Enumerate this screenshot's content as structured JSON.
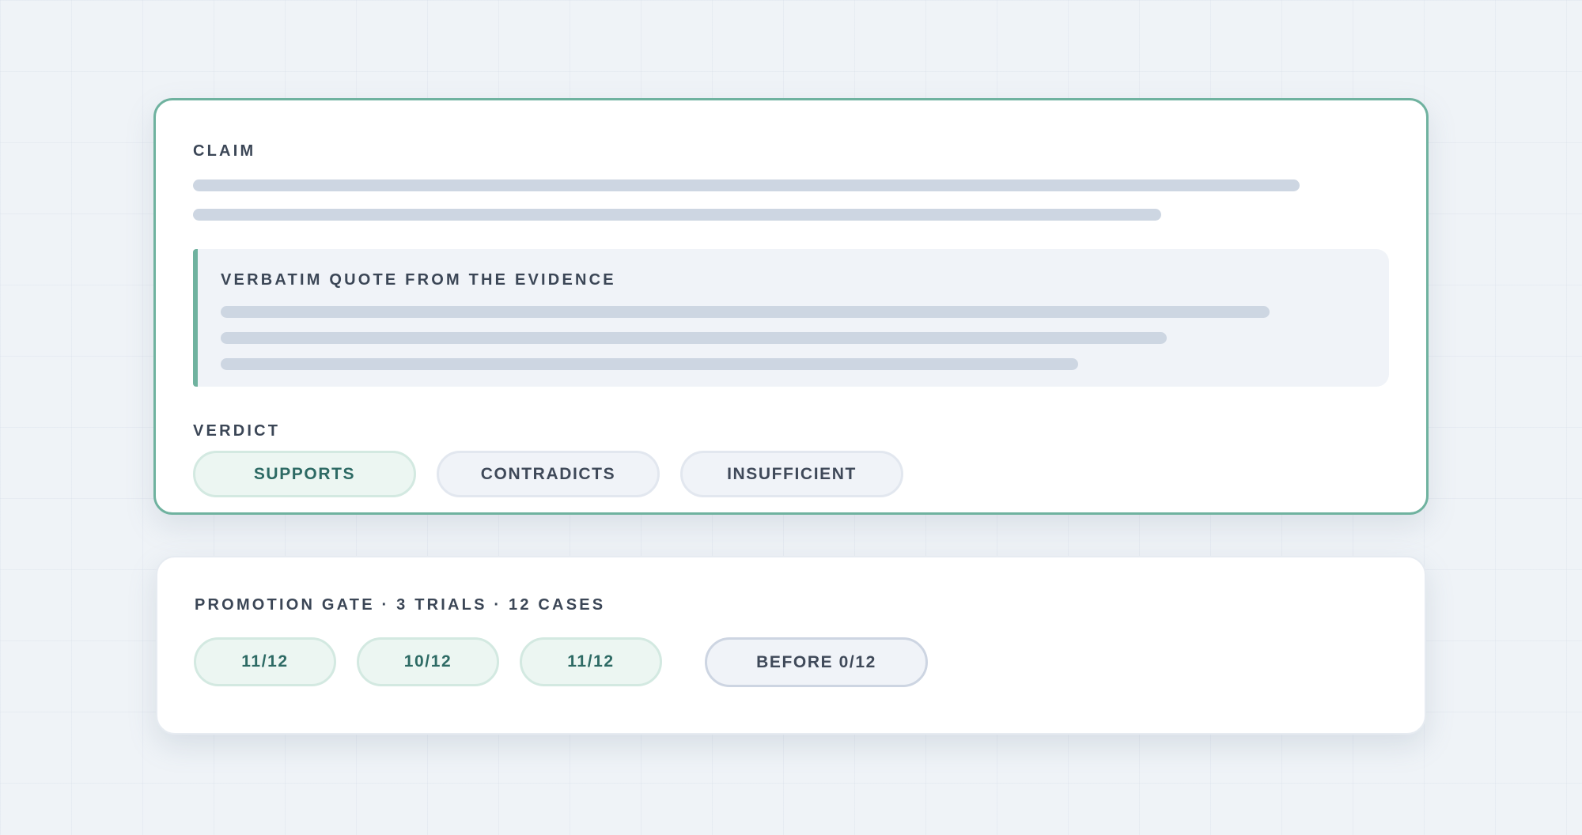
{
  "claim_card": {
    "claim_label": "CLAIM",
    "quote_label": "VERBATIM QUOTE FROM THE EVIDENCE",
    "verdict_label": "VERDICT",
    "verdict_options": [
      {
        "label": "SUPPORTS",
        "selected": true
      },
      {
        "label": "CONTRADICTS",
        "selected": false
      },
      {
        "label": "INSUFFICIENT",
        "selected": false
      }
    ]
  },
  "gate_card": {
    "title": "PROMOTION GATE · 3 TRIALS · 12 CASES",
    "trials": [
      "11/12",
      "10/12",
      "11/12"
    ],
    "before": "BEFORE 0/12"
  },
  "colors": {
    "accent": "#6fb29f",
    "selected_fill": "#ecf6f2",
    "selected_text": "#2d6a64",
    "placeholder_line": "#cdd6e2",
    "background": "#eff3f7"
  }
}
